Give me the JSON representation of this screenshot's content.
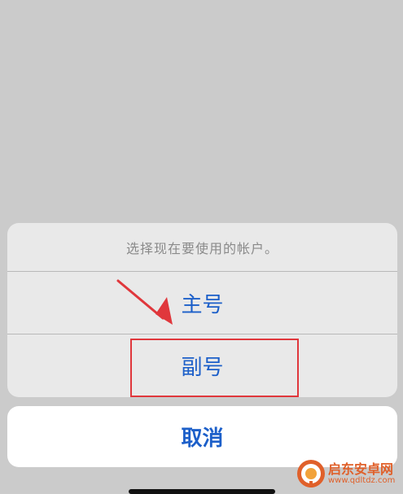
{
  "action_sheet": {
    "message": "选择现在要使用的帐户。",
    "options": [
      {
        "label": "主号"
      },
      {
        "label": "副号"
      }
    ],
    "cancel_label": "取消"
  },
  "annotation": {
    "color": "#e0373c"
  },
  "watermark": {
    "name": "启东安卓网",
    "url": "www.qdltdz.com",
    "icon": "logo-icon"
  },
  "colors": {
    "accent": "#1c5fc9",
    "backdrop": "#cbcbcb",
    "sheet": "#e9e9e9"
  }
}
